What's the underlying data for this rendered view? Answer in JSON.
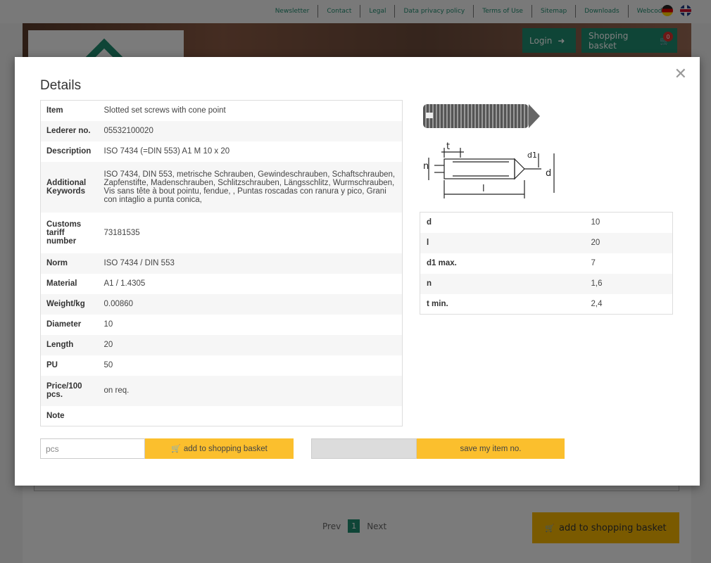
{
  "topnav": {
    "links": [
      "Newsletter",
      "Contact",
      "Legal",
      "Data privacy policy",
      "Terms of Use",
      "Sitemap",
      "Downloads",
      "Webcode"
    ]
  },
  "header": {
    "login_label": "Login",
    "basket_label": "Shopping basket",
    "basket_count": "0"
  },
  "modal": {
    "title": "Details",
    "details": [
      {
        "key": "Item",
        "value": "Slotted set screws with cone point"
      },
      {
        "key": "Lederer no.",
        "value": "05532100020"
      },
      {
        "key": "Description",
        "value": "ISO 7434 (=DIN 553) A1 M 10 x 20"
      },
      {
        "key": "Additional Keywords",
        "value": "ISO 7434, DIN 553, metrische Schrauben, Gewindeschrauben, Schaftschrauben, Zapfenstifte, Madenschrauben, Schlitzschrauben, Längsschlitz, Wurmschrauben, Vis sans tête à bout pointu, fendue, , Puntas roscadas con ranura y pico, Grani con intaglio a punta conica,"
      },
      {
        "key": "Customs tariff number",
        "value": "73181535"
      },
      {
        "key": "Norm",
        "value": "ISO 7434 / DIN 553"
      },
      {
        "key": "Material",
        "value": "A1 / 1.4305"
      },
      {
        "key": "Weight/kg",
        "value": "0.00860"
      },
      {
        "key": "Diameter",
        "value": "10"
      },
      {
        "key": "Length",
        "value": "20"
      },
      {
        "key": "PU",
        "value": "50"
      },
      {
        "key": "Price/100 pcs.",
        "value": "on req."
      },
      {
        "key": "Note",
        "value": ""
      }
    ],
    "dimensions": [
      {
        "key": "d",
        "value": "10"
      },
      {
        "key": "l",
        "value": "20"
      },
      {
        "key": "d1 max.",
        "value": "7"
      },
      {
        "key": "n",
        "value": "1,6"
      },
      {
        "key": "t min.",
        "value": "2,4"
      }
    ],
    "drawing_labels": {
      "t": "t",
      "n": "n",
      "d1": "d1",
      "d": "d",
      "l": "l"
    },
    "qty_placeholder": "pcs",
    "add_label": "add to shopping basket",
    "save_label": "save my item no."
  },
  "pager": {
    "prev": "Prev",
    "page": "1",
    "next": "Next"
  },
  "bg_add_label": "add to shopping basket"
}
